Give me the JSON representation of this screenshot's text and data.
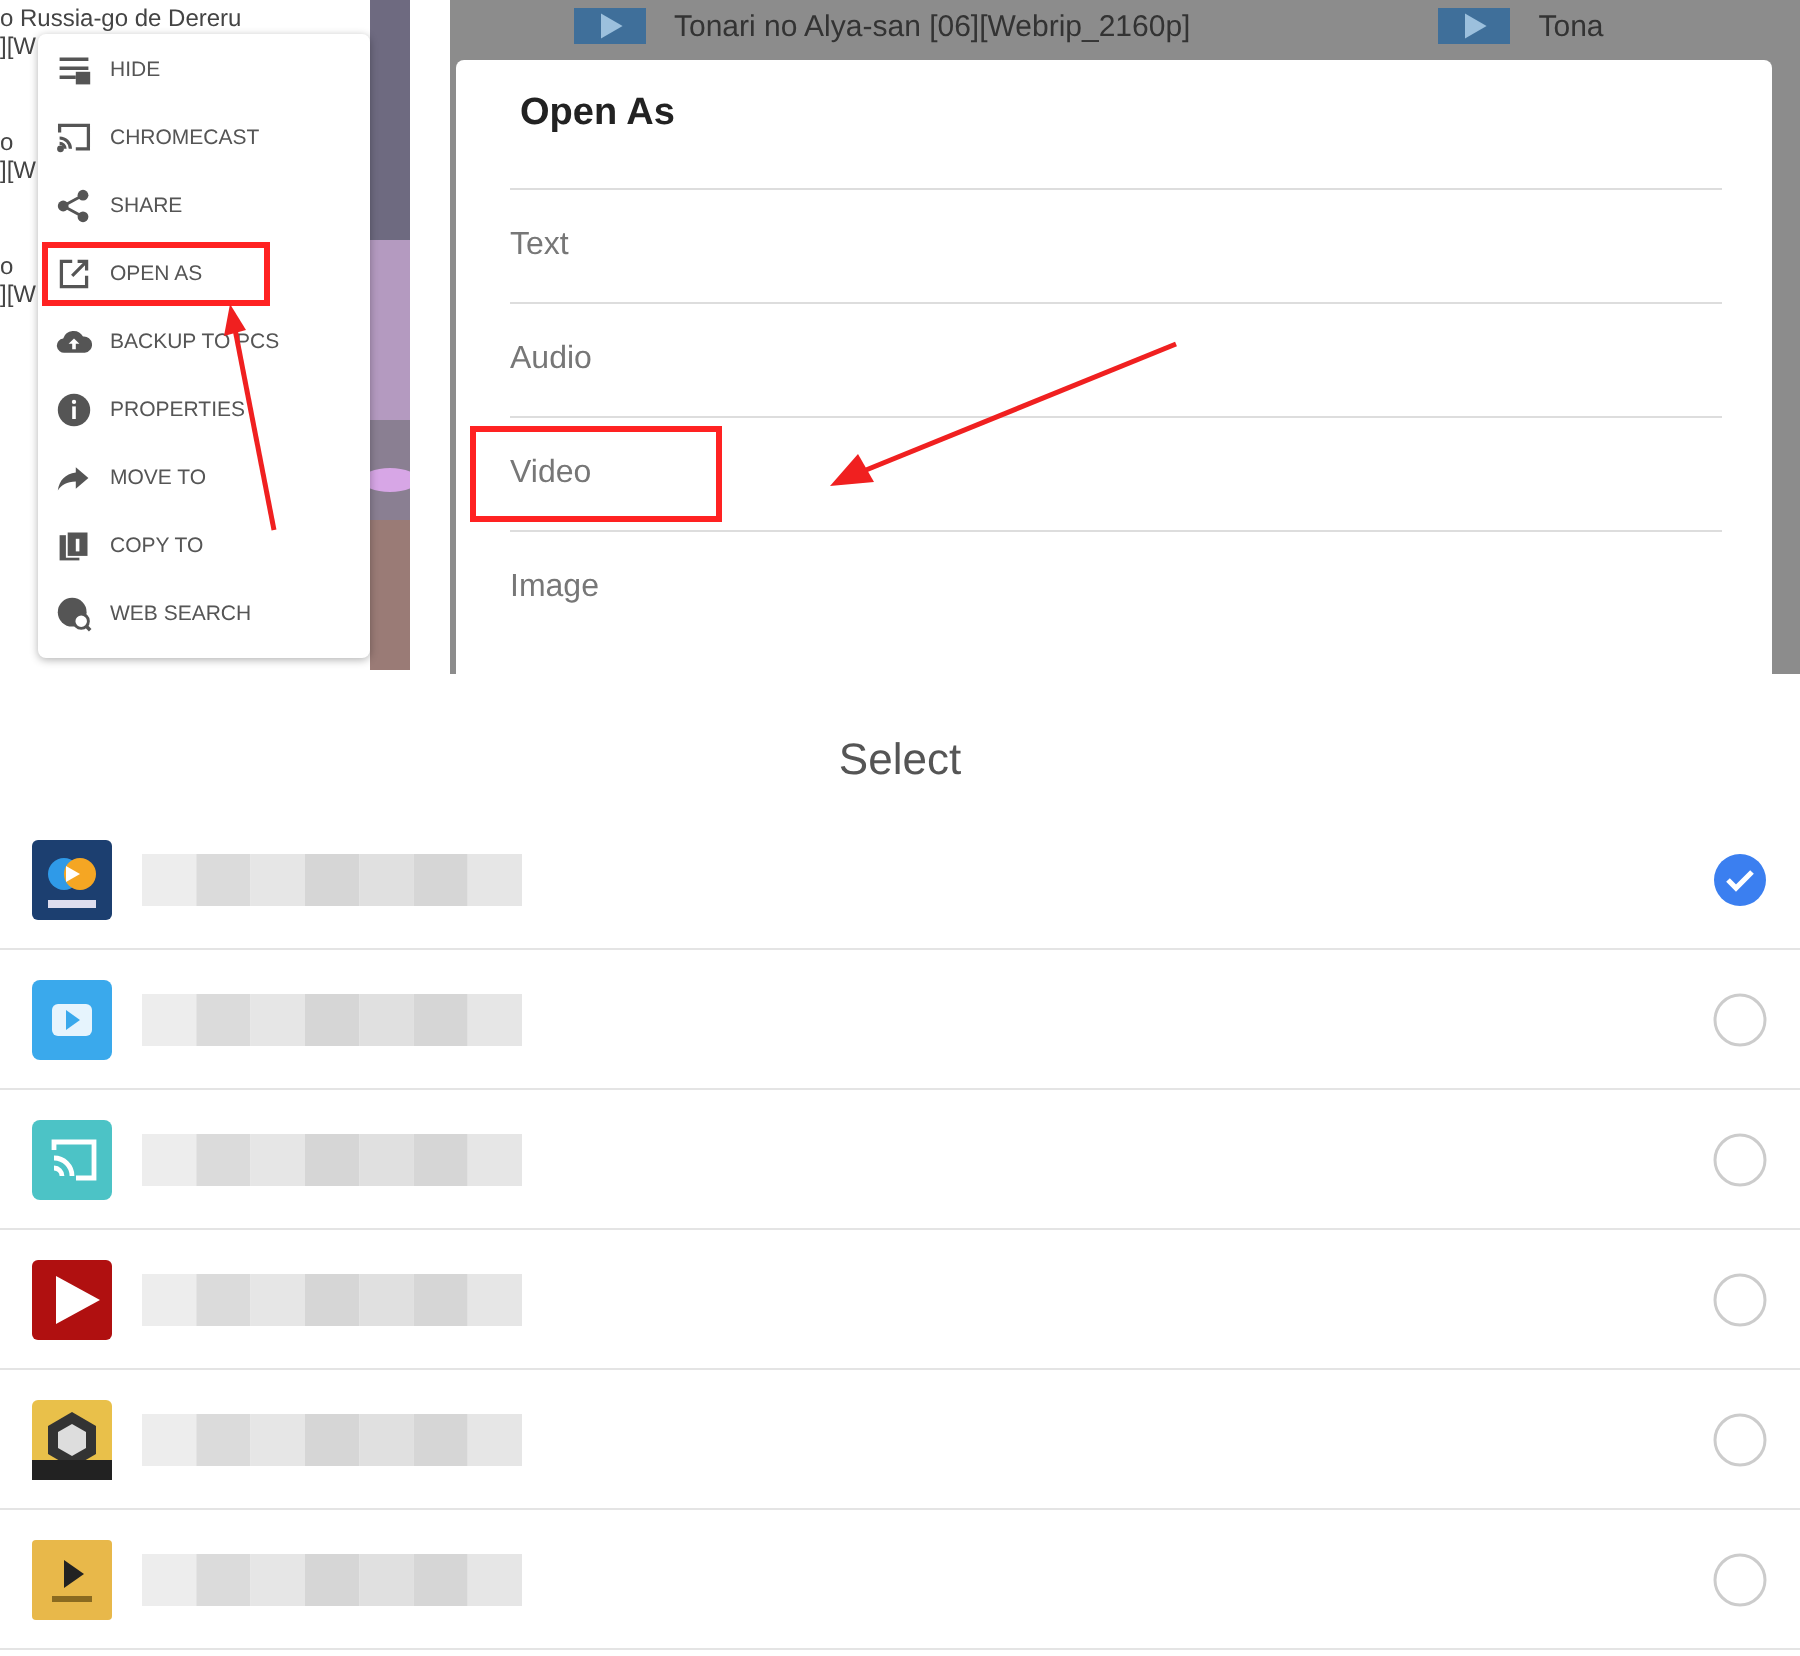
{
  "file_list": {
    "lines": [
      "o Russia-go de Dereru",
      "][W",
      "o",
      "][W",
      "o",
      "][W"
    ]
  },
  "context_menu": {
    "items": [
      {
        "label": "HIDE",
        "highlighted": false
      },
      {
        "label": "CHROMECAST",
        "highlighted": false
      },
      {
        "label": "SHARE",
        "highlighted": false
      },
      {
        "label": "OPEN AS",
        "highlighted": true
      },
      {
        "label": "BACKUP TO PCS",
        "highlighted": false
      },
      {
        "label": "PROPERTIES",
        "highlighted": false
      },
      {
        "label": "MOVE TO",
        "highlighted": false
      },
      {
        "label": "COPY TO",
        "highlighted": false
      },
      {
        "label": "WEB SEARCH",
        "highlighted": false
      }
    ]
  },
  "open_as_dialog": {
    "background_file": "Tonari no Alya-san [06][Webrip_2160p]",
    "background_file_2": "Tona",
    "title": "Open As",
    "options": [
      {
        "label": "Text",
        "highlighted": false
      },
      {
        "label": "Audio",
        "highlighted": false
      },
      {
        "label": "Video",
        "highlighted": true
      },
      {
        "label": "Image",
        "highlighted": false
      }
    ]
  },
  "select_sheet": {
    "title": "Select",
    "apps": [
      {
        "kind": "vr",
        "selected": true
      },
      {
        "kind": "player",
        "selected": false
      },
      {
        "kind": "cast",
        "selected": false
      },
      {
        "kind": "redplay",
        "selected": false
      },
      {
        "kind": "cube",
        "selected": false
      },
      {
        "kind": "goldplay",
        "selected": false
      }
    ]
  }
}
